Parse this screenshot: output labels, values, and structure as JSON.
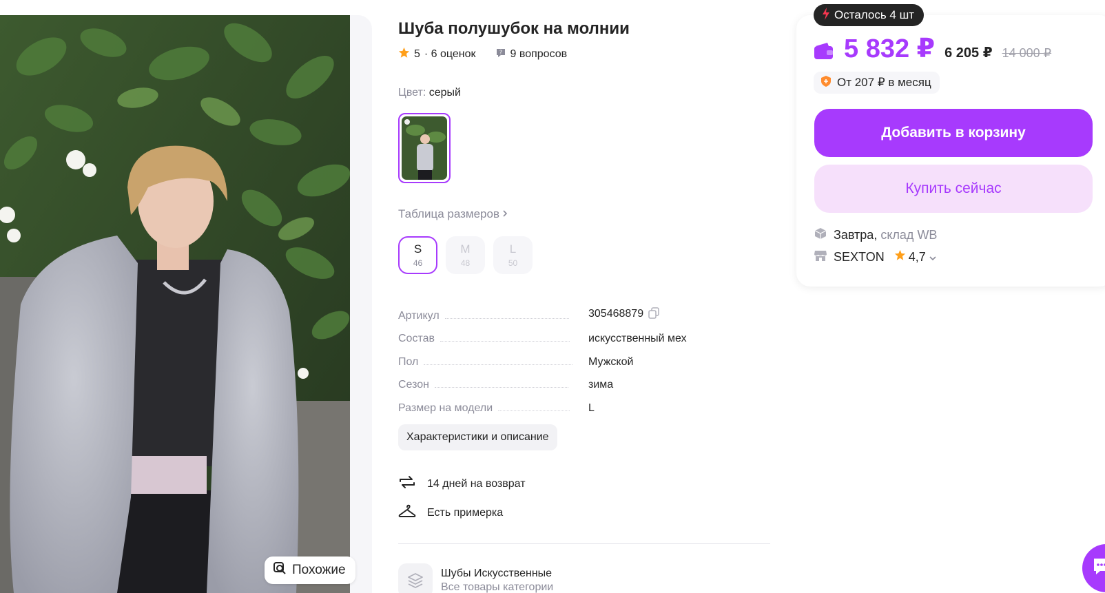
{
  "product": {
    "title": "Шуба полушубок на молнии",
    "rating": "5",
    "rating_count": "· 6 оценок",
    "questions": "9 вопросов"
  },
  "photo": {
    "similar_label": "Похожие"
  },
  "color": {
    "label": "Цвет:",
    "value": "серый"
  },
  "sizes": {
    "table_link": "Таблица размеров",
    "items": [
      {
        "letter": "S",
        "number": "46",
        "selected": true
      },
      {
        "letter": "M",
        "number": "48",
        "selected": false
      },
      {
        "letter": "L",
        "number": "50",
        "selected": false
      }
    ]
  },
  "specs": [
    {
      "key": "Артикул",
      "value": "305468879"
    },
    {
      "key": "Состав",
      "value": "искусственный мех"
    },
    {
      "key": "Пол",
      "value": "Мужской"
    },
    {
      "key": "Сезон",
      "value": "зима"
    },
    {
      "key": "Размер на модели",
      "value": "L"
    }
  ],
  "description_button": "Характеристики и описание",
  "features": {
    "returns": "14 дней на возврат",
    "fitting": "Есть примерка"
  },
  "category": {
    "name": "Шубы Искусственные",
    "link": "Все товары категории"
  },
  "purchase": {
    "stock_badge": "Осталось 4 шт",
    "price": "5 832 ₽",
    "price_regular": "6 205 ₽",
    "price_old": "14 000 ₽",
    "installment": "От 207 ₽ в месяц",
    "add_to_cart": "Добавить в корзину",
    "buy_now": "Купить сейчас",
    "delivery_day": "Завтра,",
    "delivery_place": "склад WB",
    "seller_name": "SEXTON",
    "seller_rating": "4,7"
  },
  "colors": {
    "accent": "#a73afd",
    "accent_light": "#f6e0fb",
    "star": "#ff9f1a",
    "badge_dark": "#242424",
    "bolt": "#f5364f"
  }
}
